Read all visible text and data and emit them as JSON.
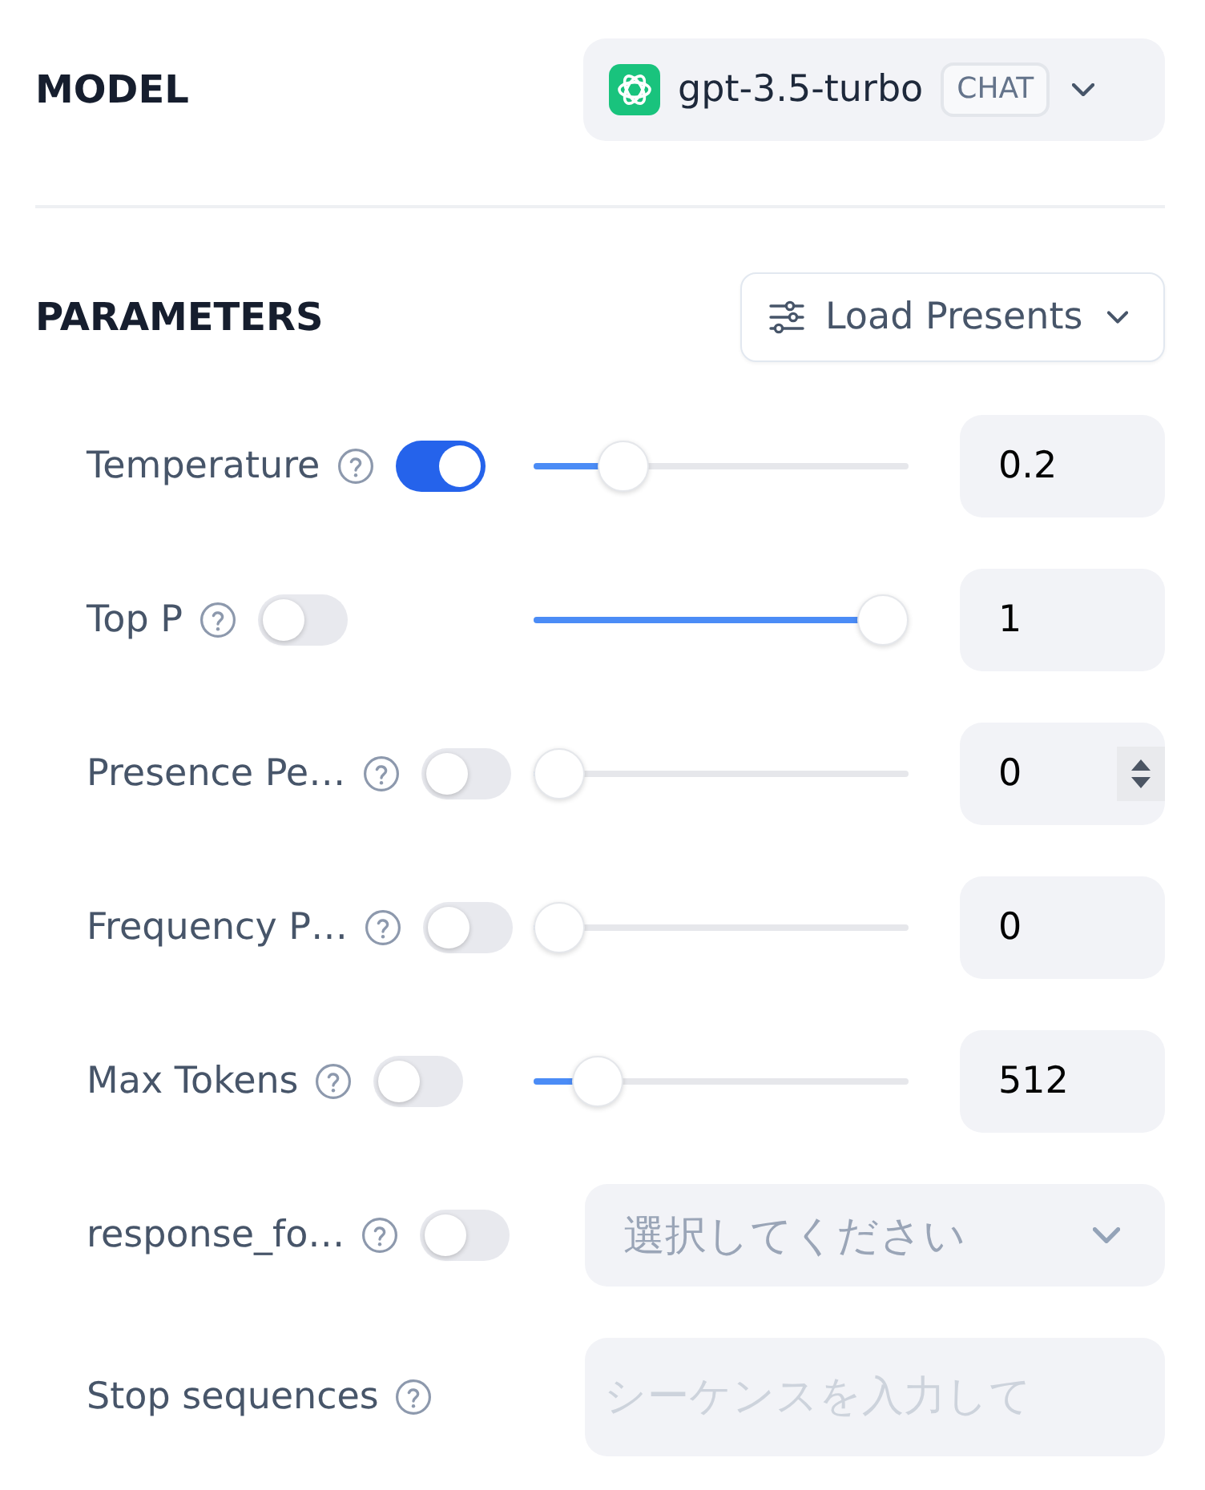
{
  "model": {
    "label": "MODEL",
    "selector": {
      "name": "gpt-3.5-turbo",
      "badge": "CHAT"
    }
  },
  "parameters": {
    "label": "PARAMETERS",
    "presets_button": "Load Presents",
    "items": [
      {
        "kind": "slider",
        "label": "Temperature",
        "enabled": true,
        "level": 0.2,
        "value": "0.2",
        "hovered": false
      },
      {
        "kind": "slider",
        "label": "Top P",
        "enabled": false,
        "level": 1,
        "value": "1",
        "hovered": false
      },
      {
        "kind": "slider",
        "label": "Presence Pe…",
        "enabled": false,
        "level": 0,
        "value": "0",
        "hovered": true
      },
      {
        "kind": "slider",
        "label": "Frequency P…",
        "enabled": false,
        "level": 0,
        "value": "0",
        "hovered": false
      },
      {
        "kind": "slider",
        "label": "Max Tokens",
        "enabled": false,
        "level": 0.12,
        "value": "512",
        "hovered": false
      },
      {
        "kind": "select",
        "label": "response_fo…",
        "enabled": false,
        "placeholder": "選択してください"
      },
      {
        "kind": "text",
        "label": "Stop sequences",
        "placeholder": "シーケンスを入力して"
      }
    ]
  }
}
